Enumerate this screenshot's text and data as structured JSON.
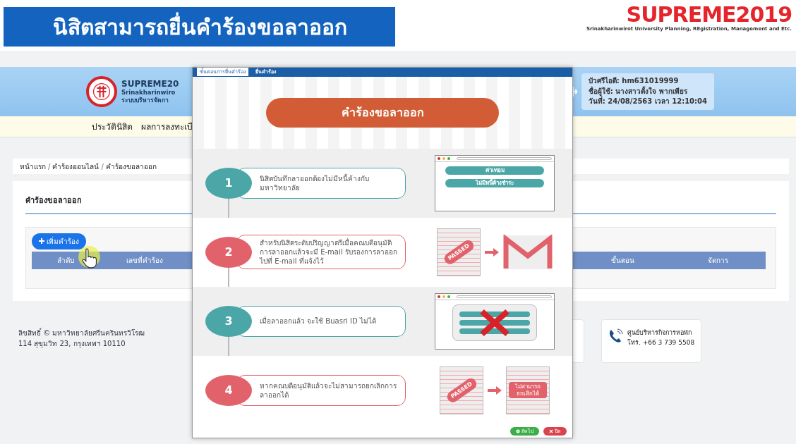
{
  "video_title": "นิสิตสามารถยื่นคำร้องขอลาออก",
  "brand": {
    "name": "SUPREME2019",
    "tagline": "Srinakharinwirot University Planning, REgistration, Management and Etc."
  },
  "site": {
    "name": "SUPREME20",
    "name_en": "Srinakharinwiro",
    "name_th": "ระบบบริหารจัดกา",
    "nav": [
      "ประวัตินิสิต",
      "ผลการลงทะเบี"
    ],
    "user_info": [
      "บัวศรีไอดี: hm631019999",
      "ชื่อผู้ใช้: นางสาวตั้งใจ พากเพียร",
      "วันที่: 24/08/2563 เวลา 12:10:04"
    ],
    "breadcrumb": [
      "หน้าแรก",
      "คำร้องออนไลน์",
      "คำร้องขอลาออก"
    ],
    "breadcrumb_separator": "/",
    "card_title": "คำร้องขอลาออก",
    "add_button": "เพิ่มคำร้อง",
    "table_columns": [
      "ลำดับ",
      "เลขที่คำร้อง",
      "ขั้นตอน",
      "จัดการ"
    ],
    "footer": {
      "copyright": "ลิขสิทธิ์ © มหาวิทยาลัยศรีนครินทรวิโรฒ",
      "address": "114 สุขุมวิท 23, กรุงเทพฯ 10110",
      "contact": {
        "title": "ศูนย์บริหารกิจการหอพัก",
        "phone": "โทร. +66 3 739 5508"
      }
    }
  },
  "modal": {
    "tabs": [
      {
        "label": "ขั้นตอนการยื่นคำร้อง",
        "selected": true
      },
      {
        "label": "ยื่นคำร้อง",
        "selected": false
      }
    ],
    "heading": "คำร้องขอลาออก",
    "steps": [
      {
        "number": "1",
        "color": "#4ba6a7",
        "kind": "fees",
        "text": "นิสิตบันทึกลาออกต้องไม่มีหนี้ค้างกับมหาวิทยาลัย",
        "labels": [
          "ค่าเทอม",
          "ไม่มีหนี้ค้างชำระ"
        ]
      },
      {
        "number": "2",
        "color": "#e2626b",
        "kind": "passed-mail",
        "text": "สำหรับนิสิตระดับปริญญาตรีเมื่อคณบดีอนุมัติการลาออกแล้วจะมี E-mail รับรองการลาออกไปที่ E-mail ที่แจ้งไว้",
        "labels": [
          "PASSED"
        ]
      },
      {
        "number": "3",
        "color": "#4ba6a7",
        "kind": "login-denied",
        "text": "เมื่อลาออกแล้ว จะใช้ Buasri ID ไม่ได้"
      },
      {
        "number": "4",
        "color": "#e2626b",
        "kind": "cannot-cancel",
        "text": "หากคณบดีอนุมัติแล้วจะไม่สามารถยกเลิกการลาออกได้",
        "labels": [
          "PASSED",
          "ไม่สามารถยกเลิกได้"
        ]
      }
    ],
    "buttons": [
      {
        "label": "ถัดไป",
        "kind": "next"
      },
      {
        "label": "ปิด",
        "kind": "close"
      }
    ]
  }
}
